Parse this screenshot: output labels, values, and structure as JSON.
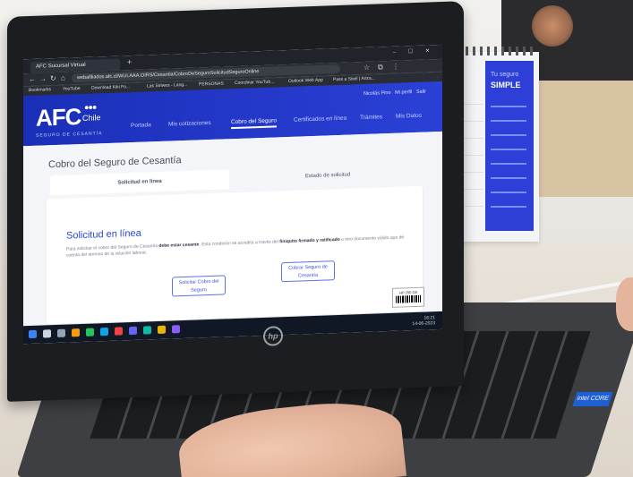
{
  "browser": {
    "tab_title": "AFC Sucursal Virtual",
    "new_tab": "+",
    "url": "webafiliados.afc.cl/WUI.AAA.OIRS/Cesantia/CobroDeSeguroSolicitudSeguroOnline",
    "window_controls": "– ☐ ✕",
    "bookmarks": [
      "Bookmarks",
      "YouTube",
      "Download Kiki Fo...",
      "Las Siriwes - Lang...",
      "PERSONAS",
      "Coordinar YouTub...",
      "Outlook Web App",
      "Pass a Sisel | Ariza..."
    ]
  },
  "afc": {
    "logo": "AFC",
    "country": "Chile",
    "dots": "●●●",
    "tagline": "SEGURO DE CESANTÍA",
    "user_name": "Nicolás Pino",
    "user_link": "Mi perfil",
    "logout": "Salir",
    "nav": [
      "Portada",
      "Mis cotizaciones",
      "Cobro del Seguro",
      "Certificados en línea",
      "Trámites",
      "Mis Datos"
    ],
    "active_nav_index": 2
  },
  "page": {
    "title": "Cobro del Seguro de Cesantía",
    "tabs": [
      "Solicitud en línea",
      "Estado de solicitud"
    ],
    "active_tab": 0,
    "card_title": "Solicitud en línea",
    "card_text_1": "Para solicitar el cobro del Seguro de Cesantía",
    "card_text_bold_1": "debe estar cesante",
    "card_text_2": ". Esta condición se acredita a través del",
    "card_text_bold_2": "finiquito firmado y ratificado",
    "card_text_3": "u otro documento válido que dé cuenta del término de la relación laboral.",
    "button_1": "Solicitar Cobro del Seguro",
    "button_2": "Cobrar Seguro de Cesantía"
  },
  "taskbar": {
    "time": "16:21",
    "date": "14-06-2023"
  },
  "calendar": {
    "heading_small": "Tu seguro",
    "heading_big": "SIMPLE"
  },
  "laptop": {
    "brand": "hp",
    "sticker_text": "HP 250 G8",
    "intel": "intel CORE"
  },
  "colors": {
    "afc_blue": "#2b40d6",
    "afc_blue_dark": "#1a2fb8",
    "link_blue": "#2a47d6"
  }
}
